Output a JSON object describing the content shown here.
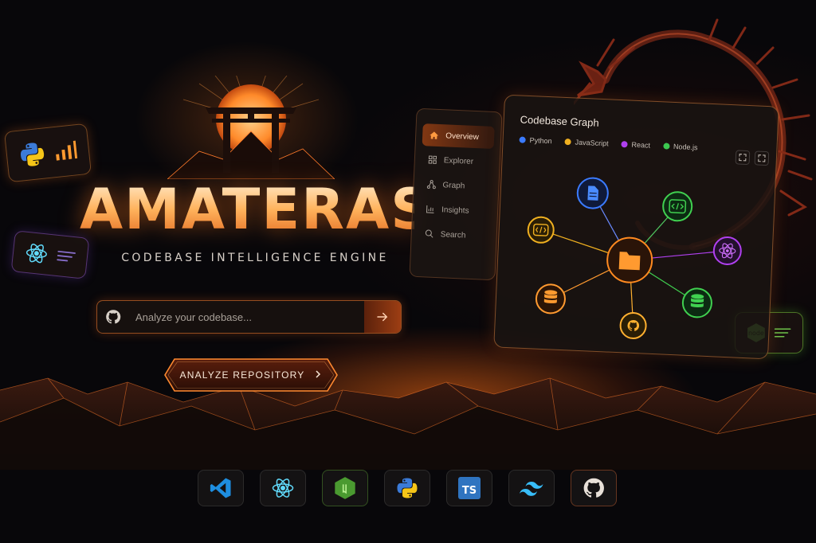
{
  "brand": {
    "title": "AMATERASU",
    "tagline": "CODEBASE INTELLIGENCE ENGINE"
  },
  "search": {
    "placeholder": "Analyze your codebase...",
    "icon": "github-icon",
    "submit_icon": "arrow-right-icon"
  },
  "cta": {
    "label": "ANALYZE REPOSITORY",
    "icon": "chevron-right-icon"
  },
  "sidebar": {
    "items": [
      {
        "label": "Overview",
        "icon": "home-icon",
        "active": true
      },
      {
        "label": "Explorer",
        "icon": "grid-icon",
        "active": false
      },
      {
        "label": "Graph",
        "icon": "graph-icon",
        "active": false
      },
      {
        "label": "Insights",
        "icon": "bar-chart-icon",
        "active": false
      },
      {
        "label": "Search",
        "icon": "search-icon",
        "active": false
      }
    ]
  },
  "graph_panel": {
    "title": "Codebase Graph",
    "legend": [
      {
        "label": "Python",
        "color": "#3b7bff"
      },
      {
        "label": "JavaScript",
        "color": "#f0b020"
      },
      {
        "label": "React",
        "color": "#b040f0"
      },
      {
        "label": "Node.js",
        "color": "#3cc850"
      }
    ],
    "nodes": [
      {
        "name": "folder-icon",
        "color": "#ff8a20"
      },
      {
        "name": "document-icon",
        "color": "#3b7bff"
      },
      {
        "name": "code-icon",
        "color": "#40d050"
      },
      {
        "name": "code-icon",
        "color": "#f0b020"
      },
      {
        "name": "react-icon",
        "color": "#b040f0"
      },
      {
        "name": "database-icon",
        "color": "#ff9a30"
      },
      {
        "name": "database-icon",
        "color": "#40d050"
      },
      {
        "name": "github-icon",
        "color": "#ffb030"
      }
    ]
  },
  "floating_cards": [
    {
      "icon": "python-logo-icon",
      "accent": "#ff9a30"
    },
    {
      "icon": "react-logo-icon",
      "accent": "#8a60e0"
    },
    {
      "icon": "nodejs-logo-icon",
      "accent": "#6cc24a"
    }
  ],
  "tech_stack": [
    {
      "icon": "vscode-icon"
    },
    {
      "icon": "react-logo-icon"
    },
    {
      "icon": "nodejs-logo-icon"
    },
    {
      "icon": "python-logo-icon"
    },
    {
      "icon": "typescript-icon",
      "label": "TS"
    },
    {
      "icon": "tailwind-icon"
    },
    {
      "icon": "github-icon"
    }
  ],
  "colors": {
    "accent": "#ff7a1a",
    "background": "#08070a"
  }
}
